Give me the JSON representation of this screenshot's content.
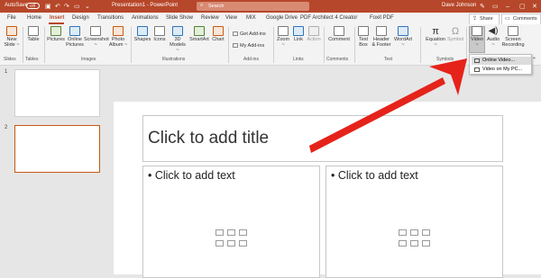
{
  "titlebar": {
    "autosave_label": "AutoSave",
    "autosave_state": "Off",
    "window_title": "Presentation1  -  PowerPoint",
    "search_placeholder": "Search",
    "user_name": "Dave Johnson",
    "accent_color": "#b7472a"
  },
  "menu": {
    "tabs": [
      "File",
      "Home",
      "Insert",
      "Design",
      "Transitions",
      "Animations",
      "Slide Show",
      "Review",
      "View",
      "MIX",
      "Google Drive",
      "PDF Architect 4 Creator",
      "Foxit PDF"
    ],
    "active_tab": "Insert",
    "share_label": "Share",
    "comments_label": "Comments"
  },
  "ribbon": {
    "new_slide": [
      "New",
      "Slide ~"
    ],
    "table": "Table",
    "pictures": "Pictures",
    "online_pictures": [
      "Online",
      "Pictures"
    ],
    "screenshot": [
      "Screenshot",
      "~"
    ],
    "photo_album": [
      "Photo",
      "Album ~"
    ],
    "shapes": "Shapes",
    "icons": "Icons",
    "models_3d": [
      "3D",
      "Models ~"
    ],
    "smartart": "SmartArt",
    "chart": "Chart",
    "get_addins": "Get Add-ins",
    "my_addins": "My Add-ins",
    "zoom": [
      "Zoom",
      "~"
    ],
    "link": "Link",
    "action": "Action",
    "comment": "Comment",
    "text_box": [
      "Text",
      "Box"
    ],
    "header_footer": [
      "Header",
      "& Footer"
    ],
    "wordart": [
      "WordArt",
      "~"
    ],
    "equation": [
      "Equation",
      "~"
    ],
    "symbol": "Symbol",
    "video": [
      "Video",
      "~"
    ],
    "audio": [
      "Audio",
      "~"
    ],
    "screen_recording": [
      "Screen",
      "Recording"
    ],
    "groups": {
      "slides": "Slides",
      "tables": "Tables",
      "images": "Images",
      "illustrations": "Illustrations",
      "addins": "Add-ins",
      "links": "Links",
      "comments": "Comments",
      "text": "Text",
      "symbols": "Symbols"
    }
  },
  "video_dropdown": {
    "items": [
      "Online Video...",
      "Video on My PC..."
    ]
  },
  "thumbnails": {
    "numbers": [
      "1",
      "2"
    ],
    "selected_color": "#c55a11"
  },
  "slide": {
    "title_placeholder": "Click to add title",
    "left_content_placeholder": "• Click to add text",
    "right_content_placeholder": "• Click to add text"
  },
  "annotation": {
    "arrow_color": "#e5231b"
  }
}
